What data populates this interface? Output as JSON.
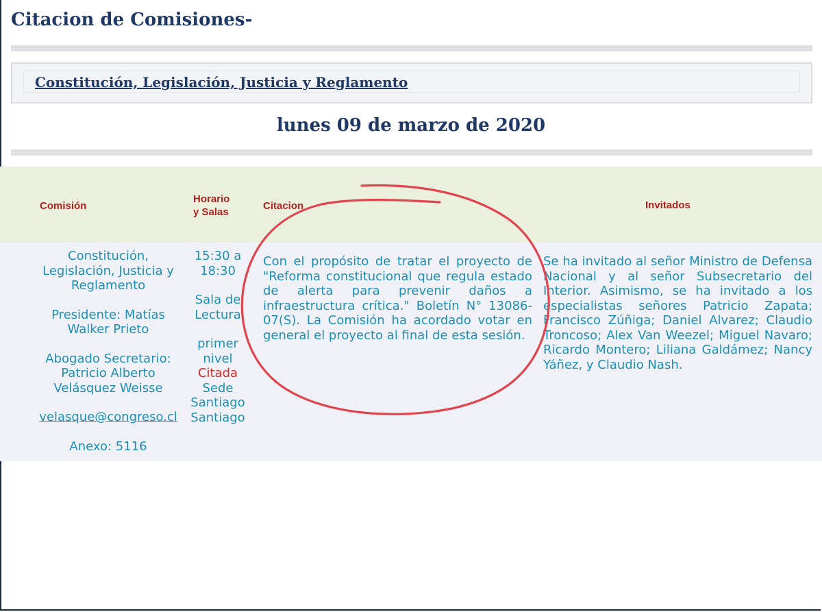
{
  "page": {
    "title": "Citacion de Comisiones-",
    "committee_link": "Constitución, Legislación, Justicia y Reglamento",
    "date": "lunes 09 de marzo de 2020"
  },
  "table": {
    "headers": {
      "comision": "Comisión",
      "horario_line1": "Horario",
      "horario_line2": "y Salas",
      "citacion": "Citacion",
      "invitados": "Invitados"
    },
    "row": {
      "comision_name": "Constitución, Legislación, Justicia y Reglamento",
      "presidente": "Presidente: Matías Walker Prieto",
      "abogado": "Abogado Secretario: Patricio Alberto Velásquez Weisse",
      "email": "velasque@congreso.cl",
      "anexo": "Anexo: 5116",
      "horario": "15:30 a 18:30",
      "sala": "Sala de Lectura",
      "nivel": "primer nivel",
      "status": "Citada",
      "sede": "Sede Santiago Santiago",
      "citacion_text": "Con el propósito de tratar el proyecto de \"Reforma constitucional que regula estado de alerta para prevenir daños a infraestructura crítica.\" Boletín N° 13086-07(S). La Comisión ha acordado votar en general el proyecto al final de esta sesión.",
      "invitados_text": "Se ha invitado al señor Ministro de Defensa Nacional y al señor Subsecretario del Interior. Asimismo, se ha invitado a los especialistas señores Patricio Zapata; Francisco Zúñiga; Daniel Alvarez; Claudio Troncoso; Alex Van Weezel; Miguel Navaro; Ricardo Montero; Liliana Galdámez; Nancy Yáñez, y Claudio Nash."
    }
  },
  "colors": {
    "heading_navy": "#1f3864",
    "header_red": "#b22020",
    "body_text_blue": "#1e8fb4",
    "status_red": "#d42b2b",
    "annotation_red": "#e0454f",
    "header_bg": "#eaf0dc",
    "body_bg": "#f0f1f6"
  }
}
